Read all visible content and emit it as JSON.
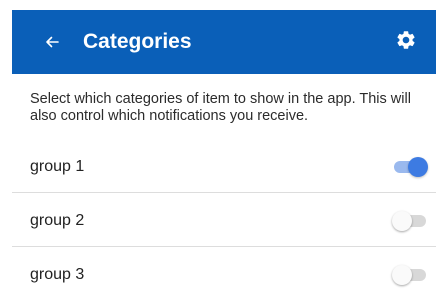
{
  "app_bar": {
    "title": "Categories",
    "back_icon": "arrow-left-icon",
    "settings_icon": "gear-icon",
    "background_color": "#0a5fb8"
  },
  "description": "Select which categories of item to show in the app. This will also control which notifications you receive.",
  "categories": [
    {
      "label": "group 1",
      "enabled": true
    },
    {
      "label": "group 2",
      "enabled": false
    },
    {
      "label": "group 3",
      "enabled": false
    }
  ],
  "colors": {
    "switch_on_thumb": "#3d7be2",
    "switch_on_track": "#9ab9ee",
    "switch_off_thumb": "#fafafa",
    "switch_off_track": "#d8d8d8"
  }
}
